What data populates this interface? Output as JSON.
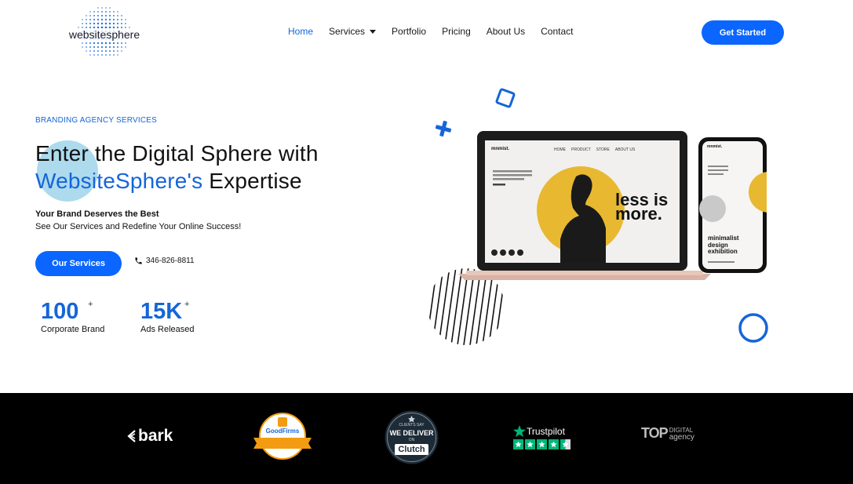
{
  "brand": {
    "logo_text": "websitesphere"
  },
  "nav": {
    "items": [
      {
        "label": "Home"
      },
      {
        "label": "Services"
      },
      {
        "label": "Portfolio"
      },
      {
        "label": "Pricing"
      },
      {
        "label": "About Us"
      },
      {
        "label": "Contact"
      }
    ],
    "cta_label": "Get Started"
  },
  "hero": {
    "eyebrow": "BRANDING AGENCY SERVICES",
    "headline_line1": "Enter the Digital Sphere with",
    "headline_accent": "WebsiteSphere's",
    "headline_rest": " Expertise",
    "sub_bold": "Your Brand Deserves the Best",
    "sub_text": "See Our Services and Redefine Your Online Success!",
    "button_label": "Our Services",
    "phone": "346-826-8811",
    "stats": [
      {
        "value": "100",
        "plus": "+",
        "label": "Corporate Brand"
      },
      {
        "value": "15K",
        "plus": "+",
        "label": "Ads Released"
      }
    ]
  },
  "mockup": {
    "laptop_brand": "mnmist.",
    "laptop_nav": [
      "HOME",
      "PRODUCT",
      "STORE",
      "ABOUT US"
    ],
    "laptop_slogan_1": "less is",
    "laptop_slogan_2": "more.",
    "phone_brand": "mnmist.",
    "phone_title_1": "minimalist",
    "phone_title_2": "design",
    "phone_title_3": "exhibition"
  },
  "partners": {
    "bark": "bark",
    "goodfirms": "GoodFirms",
    "clutch_top": "CLIENTS SAY",
    "clutch_mid": "WE DELIVER",
    "clutch_on": "ON",
    "clutch_name": "Clutch",
    "trustpilot": "Trustpilot",
    "top_big": "TOP",
    "top_small_1": "DIGITAL",
    "top_small_2": "agency"
  },
  "colors": {
    "accent": "#1565d8",
    "button": "#0a66ff",
    "band": "#000000",
    "mustard": "#e8b830"
  }
}
